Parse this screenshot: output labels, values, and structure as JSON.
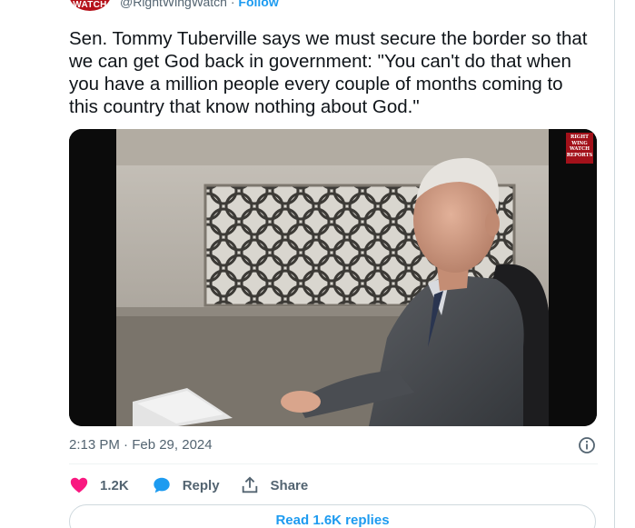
{
  "author": {
    "avatar_text": "WATCH",
    "handle": "@RightWingWatch",
    "separator": "·",
    "follow_label": "Follow"
  },
  "tweet": {
    "text": "Sen. Tommy Tuberville says we must secure the border so that we can get God back in government: \"You can't do that when you have a million people every couple of months coming to this country that know nothing about God.\"",
    "timestamp": "2:13 PM · Feb 29, 2024"
  },
  "media": {
    "badge_lines": [
      "RIGHT",
      "WING",
      "WATCH",
      "REPORTS"
    ]
  },
  "actions": {
    "like_count": "1.2K",
    "reply_label": "Reply",
    "share_label": "Share"
  },
  "replies_button": "Read 1.6K replies",
  "colors": {
    "accent": "#1d9bf0",
    "like": "#f91880",
    "text": "#0f1419",
    "muted": "#536471",
    "brand": "#b5111a"
  }
}
